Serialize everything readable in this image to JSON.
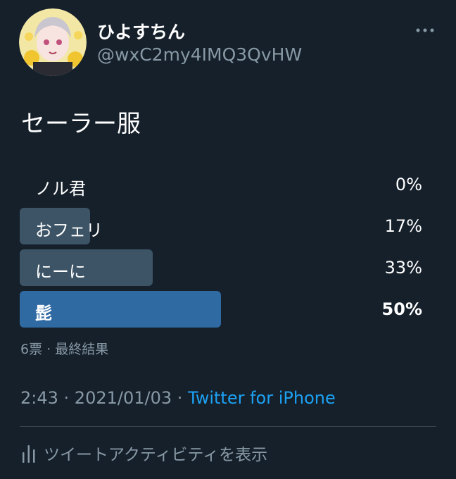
{
  "user": {
    "display_name": "ひよすちん",
    "handle": "@wxC2my4IMQ3QvHW"
  },
  "more_icon": "more-horizontal-icon",
  "tweet": {
    "text": "セーラー服"
  },
  "poll": {
    "options": [
      {
        "label": "ノル君",
        "percent_label": "0%",
        "percent": 0,
        "winner": false
      },
      {
        "label": "おフェリ",
        "percent_label": "17%",
        "percent": 17,
        "winner": false
      },
      {
        "label": "にーに",
        "percent_label": "33%",
        "percent": 33,
        "winner": false
      },
      {
        "label": "髭",
        "percent_label": "50%",
        "percent": 50,
        "winner": true
      }
    ],
    "meta": "6票 · 最終結果"
  },
  "timestamp": {
    "time": "2:43",
    "sep1": " · ",
    "date": "2021/01/03",
    "sep2": " · ",
    "source": "Twitter for iPhone"
  },
  "activity": {
    "icon": "analytics-bars-icon",
    "label": "ツイートアクティビティを表示"
  },
  "colors": {
    "background": "#15202b",
    "secondary_text": "#8899a6",
    "link": "#1da1f2",
    "bar": "#3d5466",
    "winner_bar": "#2f6aa3"
  }
}
